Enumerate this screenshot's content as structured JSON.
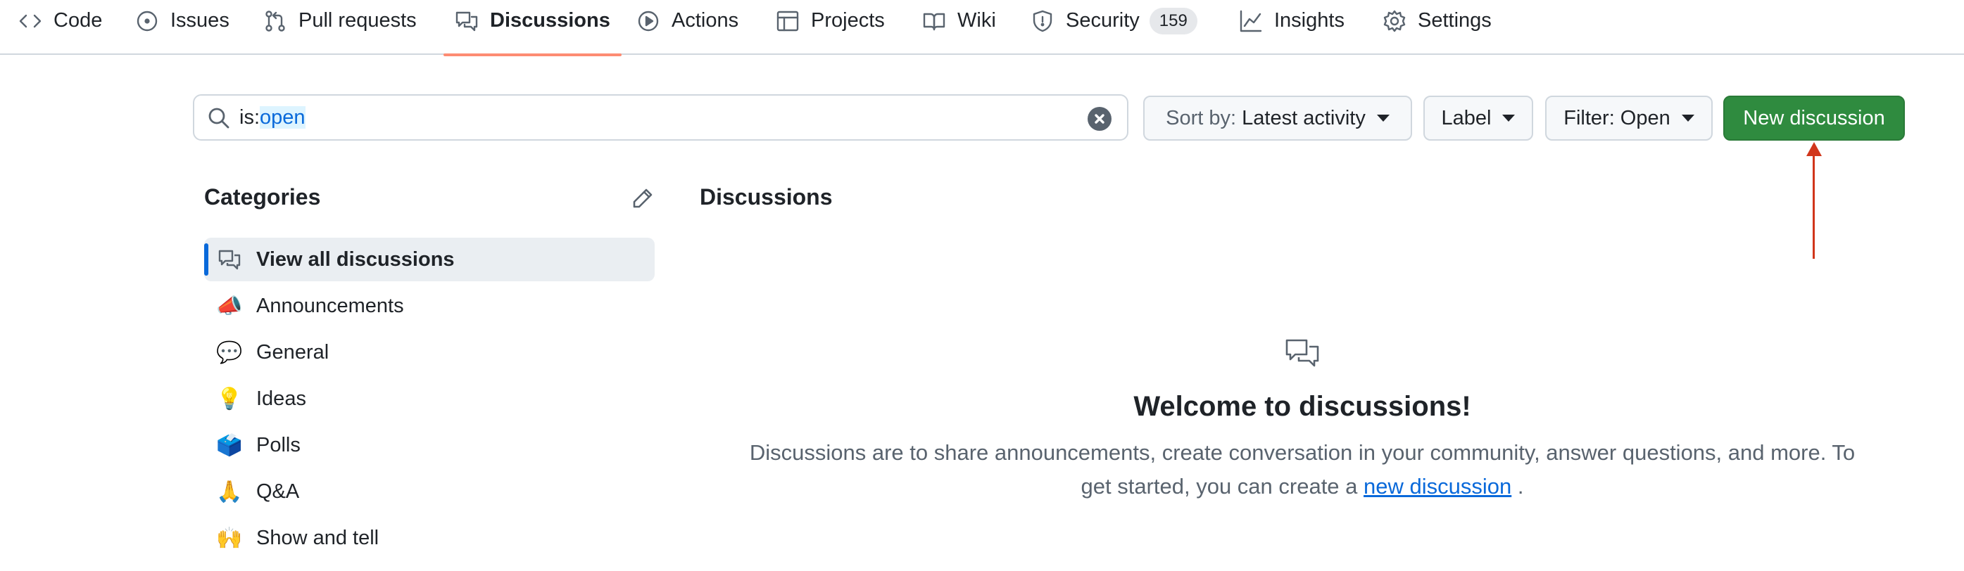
{
  "nav": {
    "items": [
      {
        "label": "Code",
        "icon": "code-icon"
      },
      {
        "label": "Issues",
        "icon": "issue-opened-icon"
      },
      {
        "label": "Pull requests",
        "icon": "git-pull-request-icon"
      },
      {
        "label": "Discussions",
        "icon": "comment-discussion-icon",
        "active": true
      },
      {
        "label": "Actions",
        "icon": "play-icon"
      },
      {
        "label": "Projects",
        "icon": "table-icon"
      },
      {
        "label": "Wiki",
        "icon": "book-icon"
      },
      {
        "label": "Security",
        "icon": "shield-icon",
        "counter": "159"
      },
      {
        "label": "Insights",
        "icon": "graph-icon"
      },
      {
        "label": "Settings",
        "icon": "gear-icon"
      }
    ]
  },
  "search": {
    "qualifier": "is:",
    "value": "open"
  },
  "toolbar": {
    "sort_prefix": "Sort by:",
    "sort_value": "Latest activity",
    "label_button": "Label",
    "filter_button": "Filter: Open",
    "new_discussion": "New discussion"
  },
  "categories": {
    "heading": "Categories",
    "items": [
      {
        "label": "View all discussions",
        "emoji": "",
        "active": true
      },
      {
        "label": "Announcements",
        "emoji": "📣"
      },
      {
        "label": "General",
        "emoji": "💬"
      },
      {
        "label": "Ideas",
        "emoji": "💡"
      },
      {
        "label": "Polls",
        "emoji": "🗳️"
      },
      {
        "label": "Q&A",
        "emoji": "🙏"
      },
      {
        "label": "Show and tell",
        "emoji": "🙌"
      }
    ]
  },
  "main": {
    "heading": "Discussions",
    "welcome_title": "Welcome to discussions!",
    "welcome_text_1": "Discussions are to share announcements, create conversation in your community, answer questions, and more. To get started, you can create a",
    "welcome_link": "new discussion",
    "welcome_text_2": "."
  },
  "colors": {
    "primary_button": "#2f8b3f",
    "active_tab_underline": "#fd8c73",
    "link": "#0969da",
    "annotation_arrow": "#d1361b"
  }
}
